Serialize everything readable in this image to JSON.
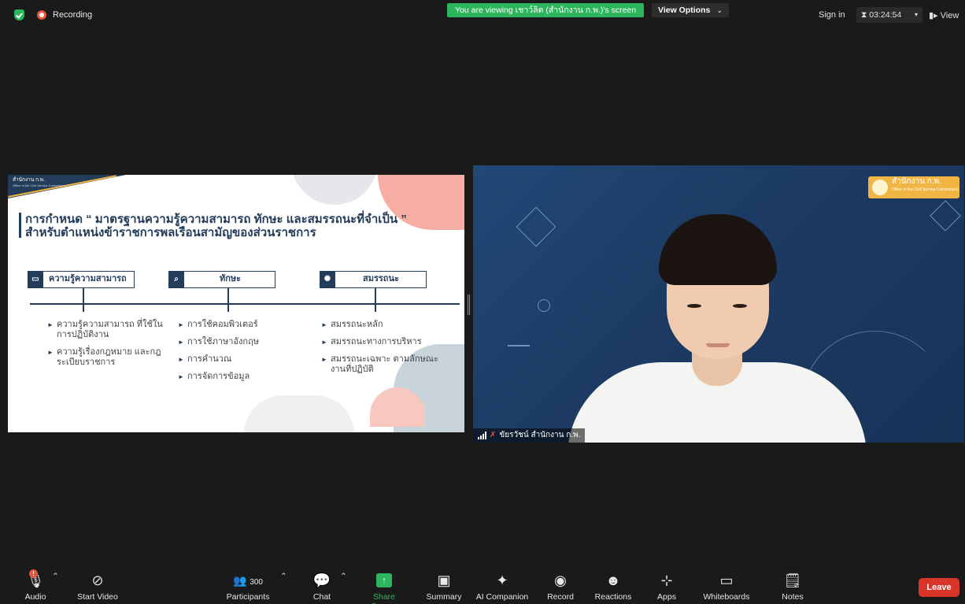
{
  "top_bar": {
    "recording_label": "Recording",
    "viewing_banner": "You are viewing เชาว์ลิต (สำนักงาน ก.พ.)'s screen",
    "view_options": "View Options",
    "sign_in": "Sign in",
    "timer": "03:24:54",
    "view": "View"
  },
  "slide": {
    "org_name": "สำนักงาน ก.พ.",
    "org_sub": "Office of the Civil Service Commission",
    "title_line1": "การกำหนด “ มาตรฐานความรู้ความสามารถ ทักษะ และสมรรถนะที่จำเป็น ”",
    "title_line2": "สำหรับตำแหน่งข้าราชการพลเรือนสามัญของส่วนราชการ",
    "columns": [
      {
        "heading": "ความรู้ความสามารถ",
        "items": [
          "ความรู้ความสามารถ ที่ใช้ในการปฏิบัติงาน",
          "ความรู้เรื่องกฎหมาย และกฎระเบียบราชการ"
        ]
      },
      {
        "heading": "ทักษะ",
        "items": [
          "การใช้คอมพิวเตอร์",
          "การใช้ภาษาอังกฤษ",
          "การคำนวณ",
          "การจัดการข้อมูล"
        ]
      },
      {
        "heading": "สมรรถนะ",
        "items": [
          "สมรรถนะหลัก",
          "สมรรถนะทางการบริหาร",
          "สมรรถนะเฉพาะ ตามลักษณะงานที่ปฏิบัติ"
        ]
      }
    ]
  },
  "video": {
    "logo_text": "สำนักงาน ก.พ.",
    "logo_sub": "Office of the Civil Service Commission",
    "participant_name": "ขัยรวัชน์ สำนักงาน ก.พ."
  },
  "toolbar": {
    "audio": "Audio",
    "audio_badge": "!",
    "start_video": "Start Video",
    "participants": "Participants",
    "participant_count": "300",
    "chat": "Chat",
    "share_screen": "Share Screen",
    "summary": "Summary",
    "ai_companion": "AI Companion",
    "record": "Record",
    "reactions": "Reactions",
    "apps": "Apps",
    "whiteboards": "Whiteboards",
    "notes": "Notes",
    "leave": "Leave"
  },
  "colors": {
    "accent_green": "#2db55d",
    "leave_red": "#d9342a",
    "slide_navy": "#233c5a"
  }
}
